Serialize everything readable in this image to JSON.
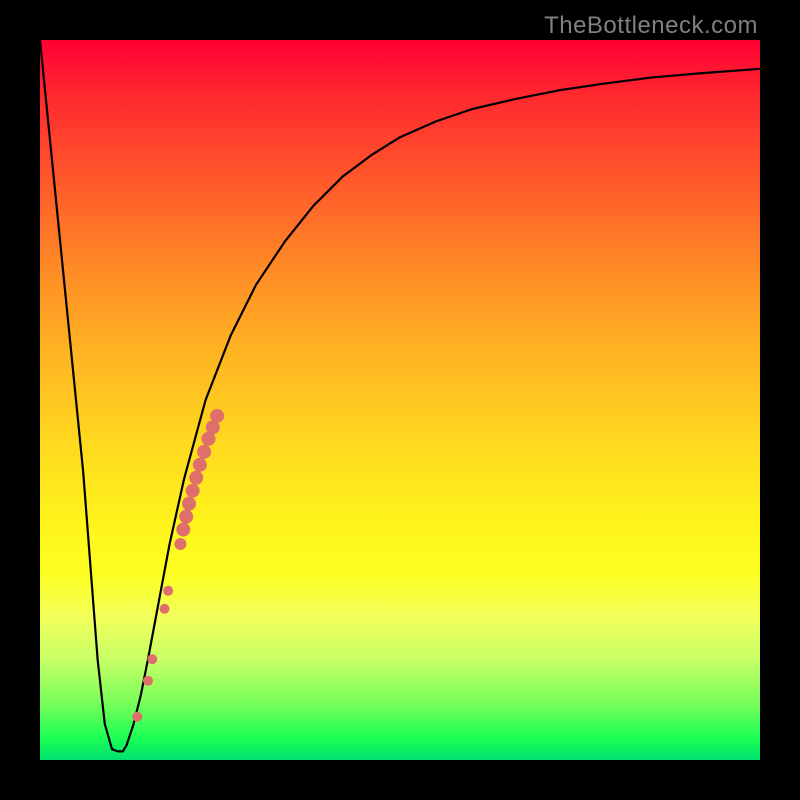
{
  "watermark": "TheBottleneck.com",
  "chart_data": {
    "type": "line",
    "title": "",
    "xlabel": "",
    "ylabel": "",
    "xlim": [
      0,
      100
    ],
    "ylim": [
      0,
      100
    ],
    "grid": false,
    "legend": false,
    "series": [
      {
        "name": "main-curve",
        "color": "#000000",
        "x": [
          0.0,
          1.5,
          3.0,
          4.5,
          6.0,
          7.0,
          8.0,
          9.0,
          10.0,
          10.8,
          11.5,
          12.0,
          13.0,
          14.0,
          15.0,
          16.5,
          18.0,
          20.0,
          23.0,
          26.5,
          30.0,
          34.0,
          38.0,
          42.0,
          46.0,
          50.0,
          55.0,
          60.0,
          66.0,
          72.0,
          78.0,
          85.0,
          92.0,
          100.0
        ],
        "y": [
          100.0,
          85.0,
          70.0,
          55.0,
          40.0,
          27.0,
          14.0,
          5.0,
          1.5,
          1.2,
          1.2,
          2.0,
          5.0,
          9.0,
          14.0,
          22.0,
          30.0,
          39.0,
          50.0,
          59.0,
          66.0,
          72.0,
          77.0,
          81.0,
          84.0,
          86.5,
          88.7,
          90.4,
          91.8,
          93.0,
          93.9,
          94.8,
          95.4,
          96.0
        ]
      }
    ],
    "annotations_points": [
      {
        "x": 13.5,
        "y": 6.0,
        "r": 5,
        "color": "#de6f6a"
      },
      {
        "x": 15.0,
        "y": 11.0,
        "r": 5,
        "color": "#de6f6a"
      },
      {
        "x": 15.6,
        "y": 14.0,
        "r": 5,
        "color": "#de6f6a"
      },
      {
        "x": 17.3,
        "y": 21.0,
        "r": 5,
        "color": "#de6f6a"
      },
      {
        "x": 17.8,
        "y": 23.5,
        "r": 5,
        "color": "#de6f6a"
      },
      {
        "x": 19.5,
        "y": 30.0,
        "r": 6,
        "color": "#de6f6a"
      },
      {
        "x": 19.9,
        "y": 32.0,
        "r": 7,
        "color": "#de6f6a"
      },
      {
        "x": 20.3,
        "y": 33.8,
        "r": 7,
        "color": "#de6f6a"
      },
      {
        "x": 20.7,
        "y": 35.6,
        "r": 7,
        "color": "#de6f6a"
      },
      {
        "x": 21.2,
        "y": 37.4,
        "r": 7,
        "color": "#de6f6a"
      },
      {
        "x": 21.7,
        "y": 39.2,
        "r": 7,
        "color": "#de6f6a"
      },
      {
        "x": 22.2,
        "y": 41.0,
        "r": 7,
        "color": "#de6f6a"
      },
      {
        "x": 22.8,
        "y": 42.8,
        "r": 7,
        "color": "#de6f6a"
      },
      {
        "x": 23.4,
        "y": 44.6,
        "r": 7,
        "color": "#de6f6a"
      },
      {
        "x": 24.0,
        "y": 46.2,
        "r": 7,
        "color": "#de6f6a"
      },
      {
        "x": 24.6,
        "y": 47.8,
        "r": 7,
        "color": "#de6f6a"
      }
    ]
  }
}
